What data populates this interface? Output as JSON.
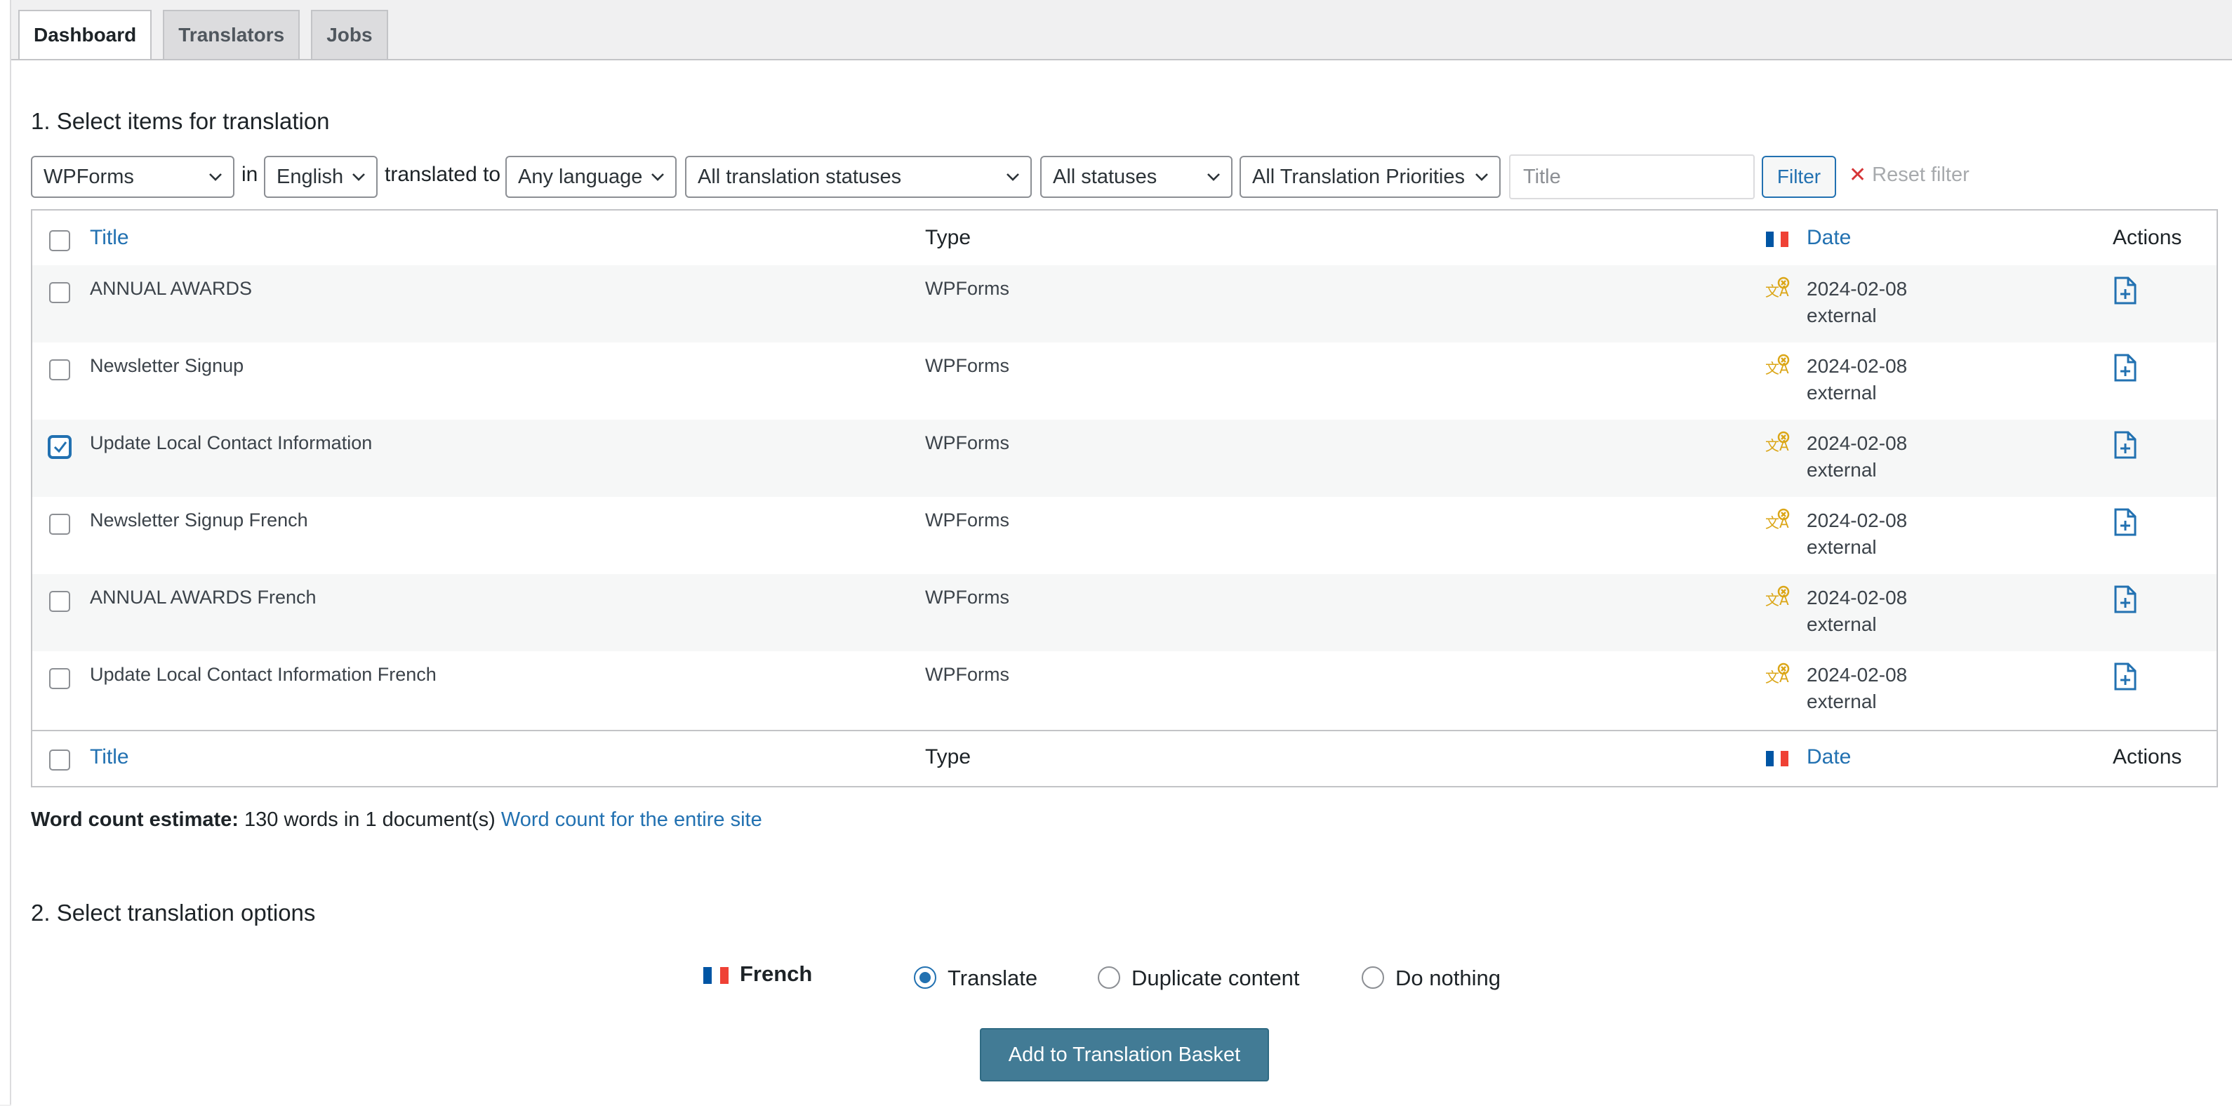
{
  "tabs": [
    {
      "label": "Dashboard",
      "active": true
    },
    {
      "label": "Translators",
      "active": false
    },
    {
      "label": "Jobs",
      "active": false
    }
  ],
  "section1": {
    "title": "1. Select items for translation"
  },
  "filters": {
    "type_select": "WPForms",
    "in_label": "in",
    "source_lang_select": "English",
    "translated_to_label": "translated to",
    "target_lang_select": "Any language",
    "translation_status_select": "All translation statuses",
    "status_select": "All statuses",
    "priority_select": "All Translation Priorities",
    "title_placeholder": "Title",
    "filter_button": "Filter",
    "reset_label": "Reset filter"
  },
  "table": {
    "columns": {
      "title": "Title",
      "type": "Type",
      "date": "Date",
      "actions": "Actions"
    },
    "rows": [
      {
        "title": "ANNUAL AWARDS",
        "type": "WPForms",
        "date": "2024-02-08",
        "source": "external",
        "checked": false
      },
      {
        "title": "Newsletter Signup",
        "type": "WPForms",
        "date": "2024-02-08",
        "source": "external",
        "checked": false
      },
      {
        "title": "Update Local Contact Information",
        "type": "WPForms",
        "date": "2024-02-08",
        "source": "external",
        "checked": true
      },
      {
        "title": "Newsletter Signup French",
        "type": "WPForms",
        "date": "2024-02-08",
        "source": "external",
        "checked": false
      },
      {
        "title": "ANNUAL AWARDS French",
        "type": "WPForms",
        "date": "2024-02-08",
        "source": "external",
        "checked": false
      },
      {
        "title": "Update Local Contact Information French",
        "type": "WPForms",
        "date": "2024-02-08",
        "source": "external",
        "checked": false
      }
    ]
  },
  "word_count": {
    "label": "Word count estimate:",
    "value": "130 words in 1 document(s)",
    "link": "Word count for the entire site"
  },
  "section2": {
    "title": "2. Select translation options",
    "language": "French",
    "options": {
      "translate": "Translate",
      "duplicate": "Duplicate content",
      "nothing": "Do nothing"
    },
    "selected": "translate",
    "submit": "Add to Translation Basket"
  },
  "colors": {
    "link": "#2271b1",
    "button_primary": "#427b95",
    "status_icon": "#dba617",
    "flag_blue": "#0055a4",
    "flag_red": "#ef4135"
  },
  "icons": {
    "status": "translation-needed-icon",
    "action": "add-document-icon",
    "select": "chevron-down-icon",
    "reset": "close-icon",
    "flag": "french-flag-icon"
  }
}
